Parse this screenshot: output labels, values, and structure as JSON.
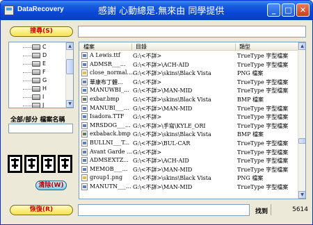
{
  "window": {
    "app_title": "DataRecovery",
    "thanks_text": "感謝 心動總是.無來由 同學提供",
    "minimize_label": "_",
    "maximize_label": "□",
    "close_label": "✕"
  },
  "search": {
    "button_label": "搜尋(S)",
    "field_value": ""
  },
  "tree": {
    "drives": [
      "C",
      "D",
      "E",
      "F",
      "G",
      "H",
      "I",
      "J"
    ]
  },
  "filename_filter": {
    "label": "全部/部分 檔案名稱",
    "value": ""
  },
  "clear_button_label": "清除(W)",
  "restore": {
    "button_label": "恢復(R)",
    "field_value": ""
  },
  "status": {
    "found_label": "找到",
    "count": "5614"
  },
  "list": {
    "columns": [
      "檔案",
      "目錄",
      "類型"
    ],
    "rows": [
      {
        "icon": "font",
        "name": "A Lewis.ttf",
        "path": "G:\\<不詳>",
        "type": "TrueType 字型檔案"
      },
      {
        "icon": "font",
        "name": "ADMSR___...",
        "path": "G:\\<不詳>\\ACH-AID",
        "type": "TrueType 字型檔案"
      },
      {
        "icon": "png",
        "name": "close_normal....",
        "path": "G:\\<不詳>\\skins\\Black Vista",
        "type": "PNG 檔案"
      },
      {
        "icon": "font",
        "name": "華康布丁體...",
        "path": "G:\\<不詳>",
        "type": "TrueType 字型檔案"
      },
      {
        "icon": "font",
        "name": "MANUWBI_...",
        "path": "G:\\<不詳>\\MAN-MID",
        "type": "TrueType 字型檔案"
      },
      {
        "icon": "bmp",
        "name": "exbar.bmp",
        "path": "G:\\<不詳>\\skins\\Black Vista",
        "type": "BMP 檔案"
      },
      {
        "icon": "font",
        "name": "MANUBI___...",
        "path": "G:\\<不詳>\\MAN-MID",
        "type": "TrueType 字型檔案"
      },
      {
        "icon": "font",
        "name": "Isadora.TTF",
        "path": "G:\\<不詳>",
        "type": "TrueType 字型檔案"
      },
      {
        "icon": "font",
        "name": "MRSDOG___...",
        "path": "G:\\<不詳>\\手寫\\KYLE_ORI",
        "type": "TrueType 字型檔案"
      },
      {
        "icon": "bmp",
        "name": "exbaback.bmp",
        "path": "G:\\<不詳>\\skins\\Black Vista",
        "type": "BMP 檔案"
      },
      {
        "icon": "font",
        "name": "BULLNI___T...",
        "path": "G:\\<不詳>\\BUL-CAR",
        "type": "TrueType 字型檔案"
      },
      {
        "icon": "font",
        "name": "Avant Garde ...",
        "path": "G:\\<不詳>",
        "type": "TrueType 字型檔案"
      },
      {
        "icon": "font",
        "name": "ADMSEXTZ...",
        "path": "G:\\<不詳>\\ACH-AID",
        "type": "TrueType 字型檔案"
      },
      {
        "icon": "font",
        "name": "MEMOB___...",
        "path": "G:\\<不詳>\\MAN-MID",
        "type": "TrueType 字型檔案"
      },
      {
        "icon": "png",
        "name": "group1.png",
        "path": "G:\\<不詳>\\skins\\Black Vista",
        "type": "PNG 檔案"
      },
      {
        "icon": "font",
        "name": "MANUTN___...",
        "path": "G:\\<不詳>\\MAN-MID",
        "type": "TrueType 字型檔案"
      }
    ]
  }
}
